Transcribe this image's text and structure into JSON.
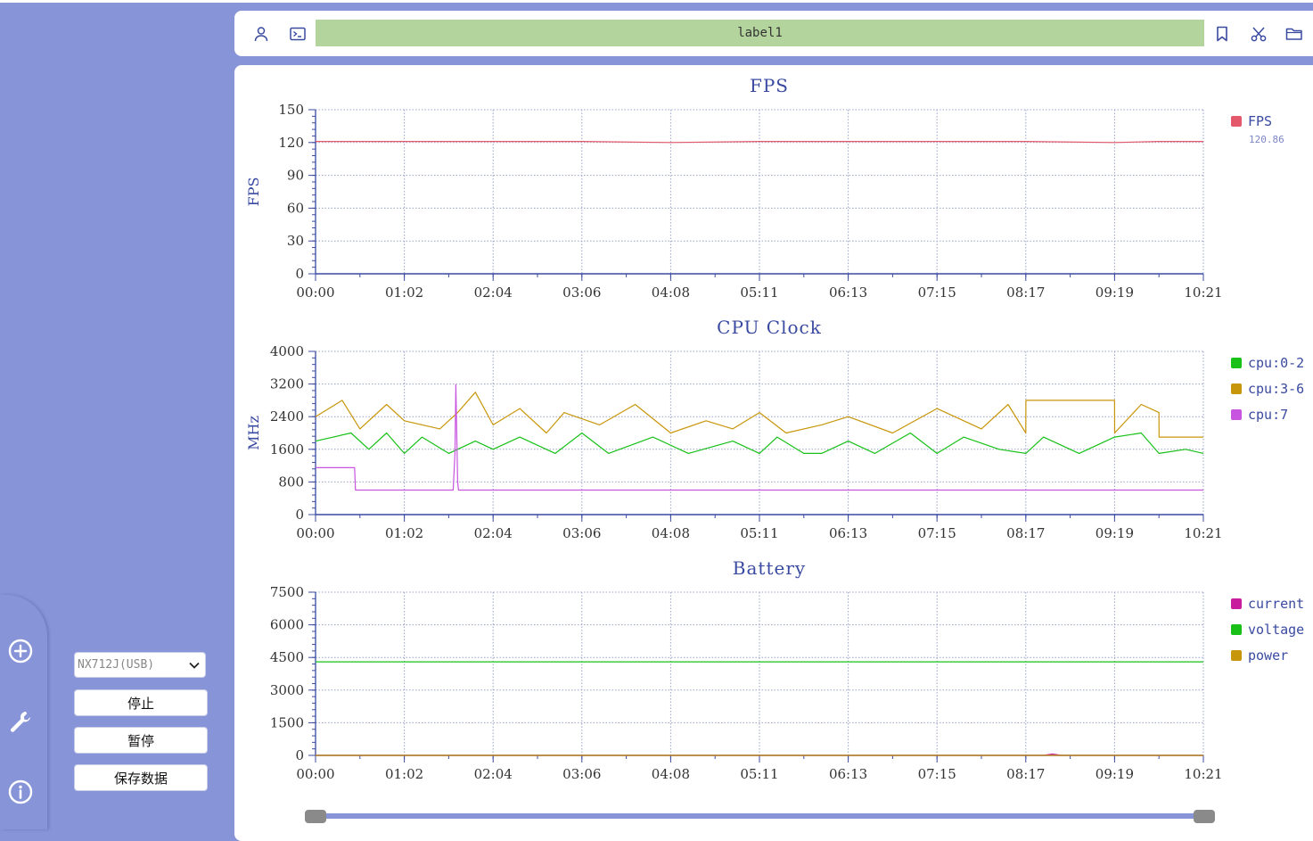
{
  "toolbar": {
    "label": "label1",
    "icons": [
      "user-icon",
      "terminal-icon",
      "bookmark-icon",
      "scissors-icon",
      "folder-icon"
    ]
  },
  "sidebar": {
    "icons": [
      "add-circle-icon",
      "wrench-icon",
      "info-icon"
    ],
    "device": "NX712J(USB)",
    "buttons": {
      "stop": "停止",
      "pause": "暂停",
      "save": "保存数据"
    }
  },
  "colors": {
    "background": "#8795d8",
    "axis": "#3a4aa0",
    "fps": "#e3586a",
    "cpu02": "#18c018",
    "cpu36": "#c8960a",
    "cpu7": "#c855e0",
    "current": "#c81e9e",
    "voltage": "#18c018",
    "power": "#c8960a"
  },
  "chart_data": [
    {
      "type": "line",
      "title": "FPS",
      "ylabel": "FPS",
      "ylim": [
        0,
        150
      ],
      "yticks": [
        0,
        30,
        60,
        90,
        120,
        150
      ],
      "xticks": [
        "00:00",
        "01:02",
        "02:04",
        "03:06",
        "04:08",
        "05:11",
        "06:13",
        "07:15",
        "08:17",
        "09:19",
        "10:21"
      ],
      "grid": true,
      "legend_position": "right",
      "series": [
        {
          "name": "FPS",
          "legend_value": "120.86",
          "x": [
            0,
            0.08,
            0.16,
            0.2,
            0.3,
            0.4,
            0.5,
            0.52,
            0.6,
            0.7,
            0.8,
            0.9,
            0.95,
            1.0
          ],
          "values": [
            121,
            121,
            121,
            121,
            121,
            120,
            121,
            121,
            121,
            121,
            121,
            120,
            121,
            121
          ]
        }
      ]
    },
    {
      "type": "line",
      "title": "CPU Clock",
      "ylabel": "MHz",
      "ylim": [
        0,
        4000
      ],
      "yticks": [
        0,
        800,
        1600,
        2400,
        3200,
        4000
      ],
      "xticks": [
        "00:00",
        "01:02",
        "02:04",
        "03:06",
        "04:08",
        "05:11",
        "06:13",
        "07:15",
        "08:17",
        "09:19",
        "10:21"
      ],
      "grid": true,
      "legend_position": "right",
      "series": [
        {
          "name": "cpu:0-2",
          "x": [
            0,
            0.04,
            0.06,
            0.08,
            0.1,
            0.12,
            0.15,
            0.18,
            0.2,
            0.23,
            0.27,
            0.3,
            0.33,
            0.38,
            0.42,
            0.47,
            0.5,
            0.52,
            0.55,
            0.57,
            0.6,
            0.63,
            0.67,
            0.7,
            0.73,
            0.77,
            0.8,
            0.82,
            0.86,
            0.9,
            0.93,
            0.95,
            0.98,
            1.0
          ],
          "values": [
            1800,
            2000,
            1600,
            2000,
            1500,
            1900,
            1500,
            1800,
            1600,
            1900,
            1500,
            2000,
            1500,
            1900,
            1500,
            1800,
            1500,
            1900,
            1500,
            1500,
            1800,
            1500,
            2000,
            1500,
            1900,
            1600,
            1500,
            1900,
            1500,
            1900,
            2000,
            1500,
            1600,
            1500
          ]
        },
        {
          "name": "cpu:3-6",
          "x": [
            0,
            0.03,
            0.05,
            0.08,
            0.1,
            0.14,
            0.16,
            0.18,
            0.2,
            0.23,
            0.26,
            0.28,
            0.32,
            0.36,
            0.4,
            0.44,
            0.47,
            0.5,
            0.53,
            0.57,
            0.6,
            0.65,
            0.7,
            0.75,
            0.78,
            0.8,
            0.8001,
            0.9,
            0.9001,
            0.93,
            0.95,
            0.9501,
            1.0
          ],
          "values": [
            2400,
            2800,
            2100,
            2700,
            2300,
            2100,
            2500,
            3000,
            2200,
            2600,
            2000,
            2500,
            2200,
            2700,
            2000,
            2300,
            2100,
            2500,
            2000,
            2200,
            2400,
            2000,
            2600,
            2100,
            2700,
            2000,
            2800,
            2800,
            2000,
            2700,
            2500,
            1900,
            1900
          ]
        },
        {
          "name": "cpu:7",
          "x": [
            0,
            0.044,
            0.045,
            0.155,
            0.157,
            0.158,
            0.16,
            0.161,
            1.0
          ],
          "values": [
            1150,
            1150,
            600,
            600,
            1500,
            3180,
            800,
            600,
            600
          ]
        }
      ]
    },
    {
      "type": "line",
      "title": "Battery",
      "ylabel": "",
      "ylim": [
        0,
        7500
      ],
      "yticks": [
        0,
        1500,
        3000,
        4500,
        6000,
        7500
      ],
      "xticks": [
        "00:00",
        "01:02",
        "02:04",
        "03:06",
        "04:08",
        "05:11",
        "06:13",
        "07:15",
        "08:17",
        "09:19",
        "10:21"
      ],
      "grid": true,
      "legend_position": "right",
      "series": [
        {
          "name": "current",
          "x": [
            0,
            0.82,
            0.83,
            0.84,
            1.0
          ],
          "values": [
            0,
            0,
            60,
            0,
            0
          ]
        },
        {
          "name": "voltage",
          "x": [
            0,
            1.0
          ],
          "values": [
            4300,
            4300
          ]
        },
        {
          "name": "power",
          "x": [
            0,
            1.0
          ],
          "values": [
            0,
            0
          ]
        }
      ]
    }
  ]
}
